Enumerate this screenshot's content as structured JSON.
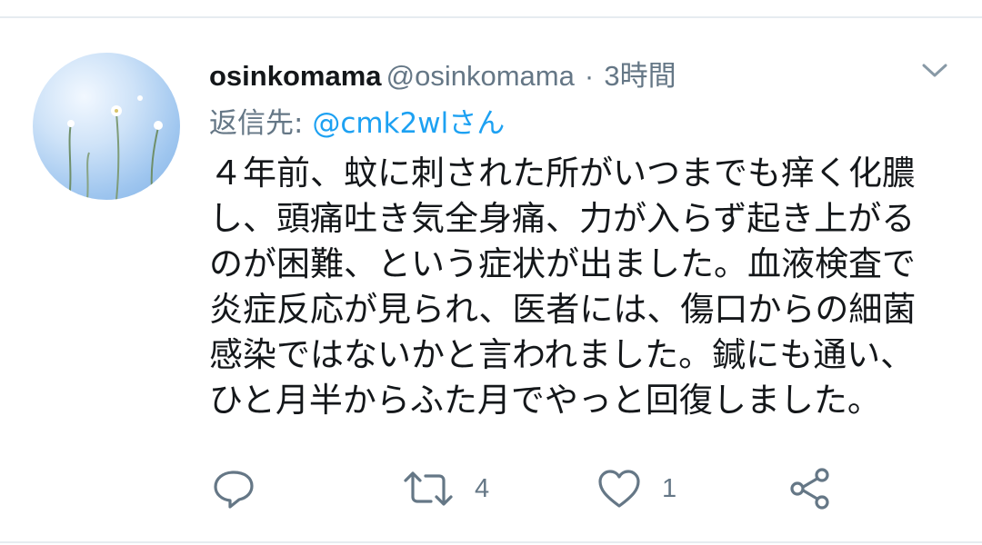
{
  "tweet": {
    "display_name": "osinkomama",
    "handle": "@osinkomama",
    "separator": "·",
    "time": "3時間",
    "reply_label": "返信先:",
    "reply_user": "@cmk2wlさん",
    "lines": [
      "４年前、蚊に刺された所がいつまでも痒く化膿",
      "し、頭痛吐き気全身痛、力が入らず起き上がる",
      "のが困難、という症状が出ました。血液検査で",
      "炎症反応が見られ、医者には、傷口からの細菌",
      "感染ではないかと言われました。鍼にも通い、",
      "ひと月半からふた月でやっと回復しました。"
    ]
  },
  "actions": {
    "retweet_count": "4",
    "like_count": "1"
  },
  "icons": {
    "reply": "reply-icon",
    "retweet": "retweet-icon",
    "like": "heart-icon",
    "share": "share-icon",
    "menu": "chevron-down-icon"
  },
  "colors": {
    "text": "#14171a",
    "secondary": "#657786",
    "link": "#1da1f2",
    "divider": "#e6ecf0"
  }
}
